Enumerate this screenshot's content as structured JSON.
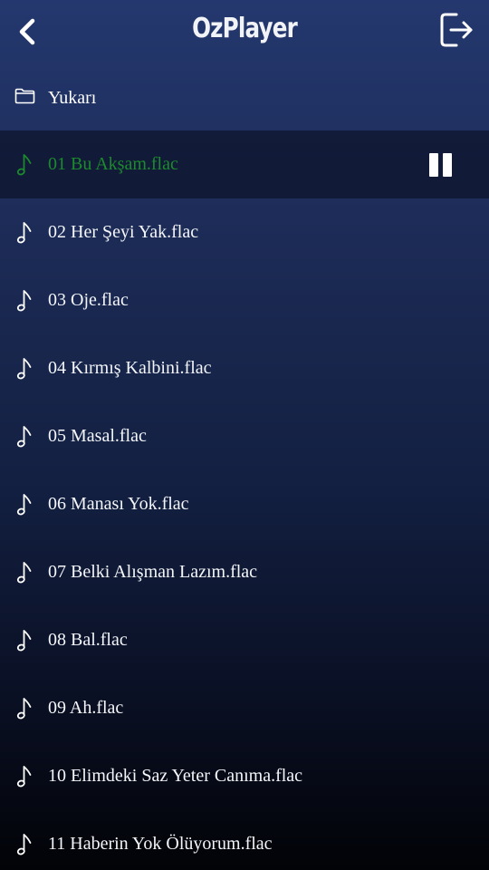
{
  "header": {
    "app_title": "OzPlayer",
    "back_icon": "chevron-left-icon",
    "exit_icon": "logout-icon"
  },
  "navigation": {
    "up_label": "Yukarı",
    "up_icon": "folder-icon"
  },
  "tracks": [
    {
      "title": "01 Bu Akşam.flac",
      "playing": true
    },
    {
      "title": "02 Her Şeyi Yak.flac",
      "playing": false
    },
    {
      "title": "03 Oje.flac",
      "playing": false
    },
    {
      "title": "04 Kırmış Kalbini.flac",
      "playing": false
    },
    {
      "title": "05 Masal.flac",
      "playing": false
    },
    {
      "title": "06 Manası Yok.flac",
      "playing": false
    },
    {
      "title": "07 Belki Alışman Lazım.flac",
      "playing": false
    },
    {
      "title": "08 Bal.flac",
      "playing": false
    },
    {
      "title": "09 Ah.flac",
      "playing": false
    },
    {
      "title": "10 Elimdeki Saz Yeter Canıma.flac",
      "playing": false
    },
    {
      "title": "11 Haberin Yok Ölüyorum.flac",
      "playing": false
    }
  ],
  "playback_control_icon": "pause-icon",
  "colors": {
    "playing_text": "#1d8a2e",
    "default_text": "#ffffff",
    "active_row_bg": "#0c1229",
    "gradient_top": "#24386f",
    "gradient_bottom": "#020307"
  }
}
